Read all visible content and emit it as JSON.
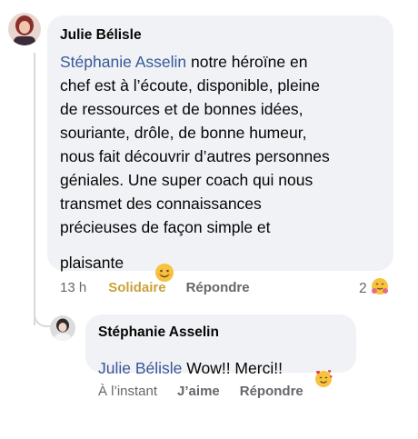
{
  "comment": {
    "author": "Julie Bélisle",
    "mention": "Stéphanie Asselin",
    "lines": [
      " notre héroïne en",
      "chef est à l’écoute, disponible, pleine",
      "de ressources et de bonnes idées,",
      "souriante, drôle, de bonne humeur,",
      "nous fait découvrir d’autres personnes",
      "géniales. Une super coach qui nous",
      "transmet des connaissances",
      "précieuses de façon simple et",
      "plaisante "
    ],
    "time": "13 h",
    "react_label": "Solidaire",
    "reply_label": "Répondre",
    "reaction_count": "2",
    "end_emoji": "smiling-face-icon",
    "reaction_emoji": "hug-face-icon"
  },
  "reply": {
    "author": "Stéphanie Asselin",
    "mention": "Julie Bélisle",
    "text": " Wow!! Merci!! ",
    "emoji": "smiling-face-with-hearts-icon",
    "time": "À l’instant",
    "react_label": "J’aime",
    "reply_label": "Répondre"
  },
  "colors": {
    "bubble": "#f0f2f5",
    "mention": "#385898",
    "solidaire": "#c9a23a",
    "meta": "#65676b"
  }
}
